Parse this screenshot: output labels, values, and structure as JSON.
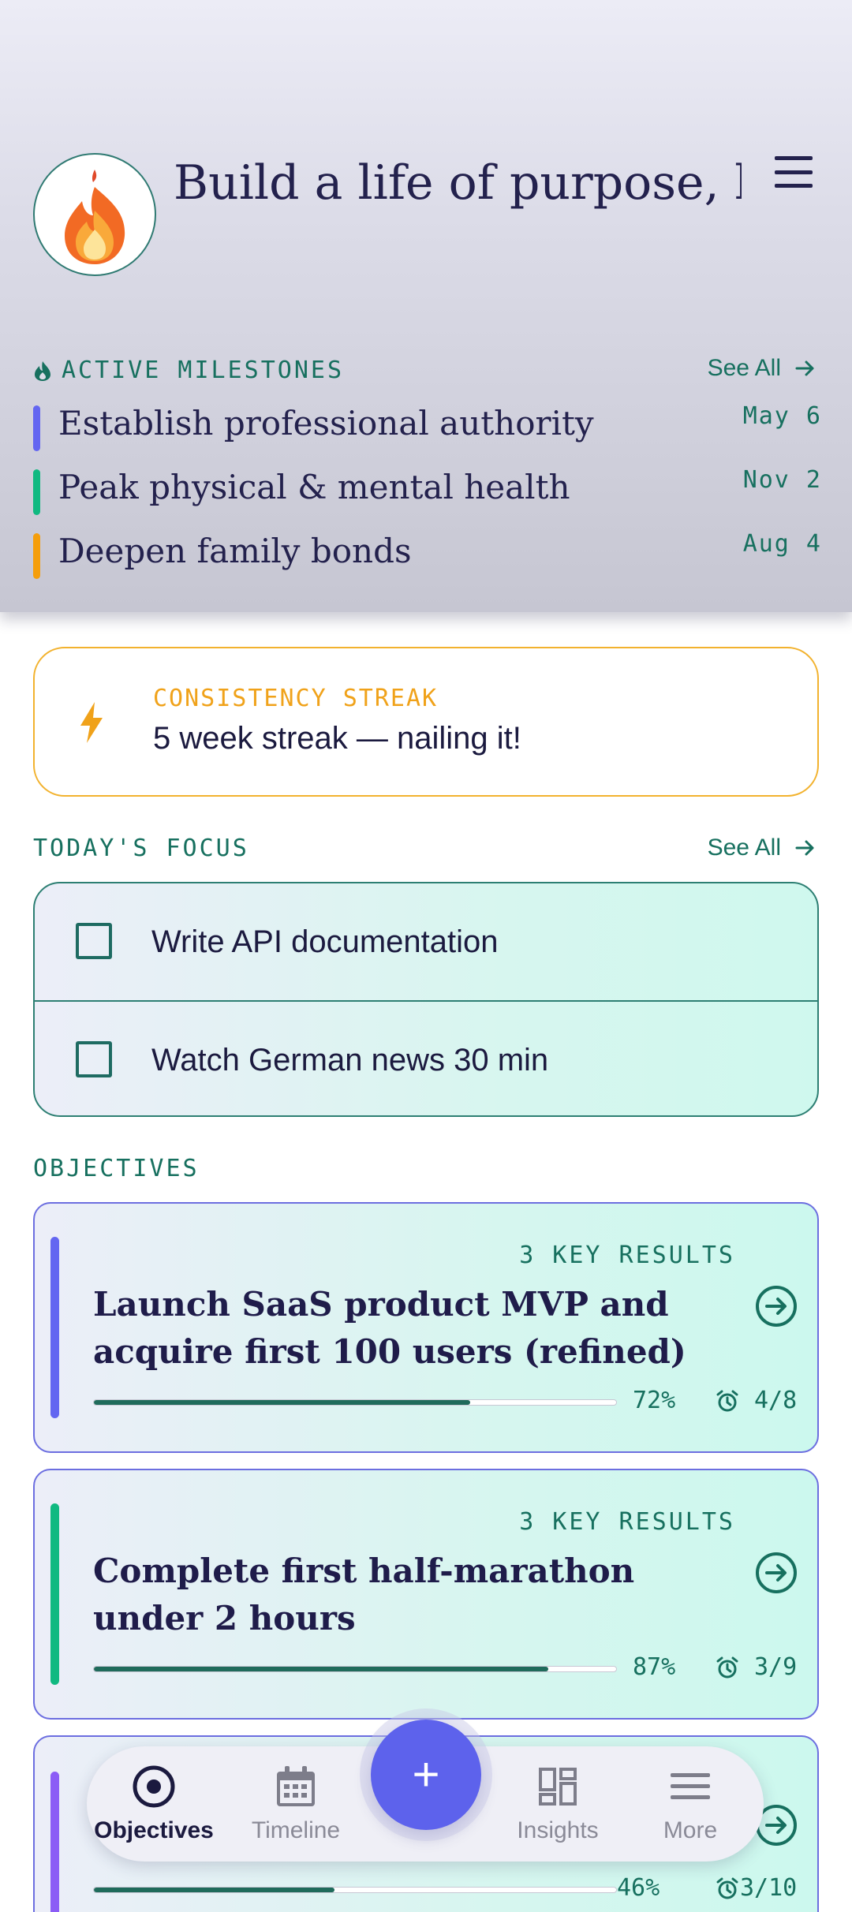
{
  "header": {
    "title": "Build a life of purpose, health, and creative im…",
    "avatar_icon": "flame-icon",
    "menu_icon": "hamburger-menu-icon"
  },
  "milestones": {
    "label": "ACTIVE MILESTONES",
    "see_all": "See All",
    "items": [
      {
        "text": "Establish professional authority",
        "date": "May 6",
        "color": "#6366f1"
      },
      {
        "text": "Peak physical & mental health",
        "date": "Nov 2",
        "color": "#10b981"
      },
      {
        "text": "Deepen family bonds",
        "date": "Aug 4",
        "color": "#f59e0b"
      }
    ]
  },
  "streak": {
    "label": "CONSISTENCY STREAK",
    "value": "5 week streak — nailing it!"
  },
  "focus": {
    "label": "TODAY'S FOCUS",
    "see_all": "See All",
    "tasks": [
      {
        "text": "Write API documentation",
        "checked": false
      },
      {
        "text": "Watch German news 30 min",
        "checked": false
      }
    ]
  },
  "objectives": {
    "label": "OBJECTIVES",
    "items": [
      {
        "key_results": "3 KEY RESULTS",
        "title": "Launch SaaS product MVP and acquire first 100 users (refined)",
        "percent": "72%",
        "progress": 0.72,
        "count": "4/8",
        "color": "#6366f1"
      },
      {
        "key_results": "3 KEY RESULTS",
        "title": "Complete first half-marathon under 2 hours",
        "percent": "87%",
        "progress": 0.87,
        "count": "3/9",
        "color": "#10b981"
      },
      {
        "key_results": "",
        "title": "",
        "percent": "46%",
        "progress": 0.46,
        "count": "3/10",
        "color": "#8b5cf6"
      }
    ]
  },
  "nav": {
    "items": [
      {
        "label": "Objectives",
        "icon": "target-icon",
        "active": true
      },
      {
        "label": "Timeline",
        "icon": "calendar-icon",
        "active": false
      },
      {
        "label": "Insights",
        "icon": "dashboard-icon",
        "active": false
      },
      {
        "label": "More",
        "icon": "more-menu-icon",
        "active": false
      }
    ],
    "fab_label": "+"
  }
}
